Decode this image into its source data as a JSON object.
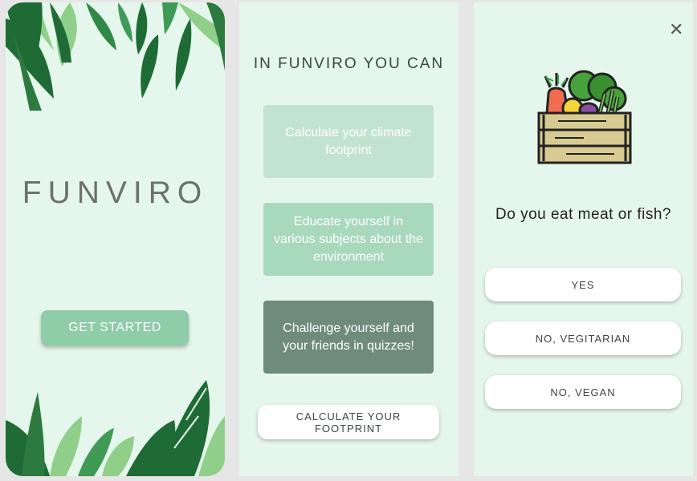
{
  "screen1": {
    "brand": "FUNVIRO",
    "start_label": "GET STARTED"
  },
  "screen2": {
    "title": "IN FUNVIRO YOU CAN",
    "cards": [
      "Calculate your climate footprint",
      "Educate yourself in various subjects about the environment",
      "Challenge yourself and your friends in quizzes!"
    ],
    "cta_label": "CALCULATE YOUR FOOTPRINT"
  },
  "screen3": {
    "close_icon": "close-icon",
    "illustration": "vegetable-crate-icon",
    "question": "Do you eat meat or fish?",
    "options": [
      "YES",
      "NO, VEGITARIAN",
      "NO, VEGAN"
    ]
  },
  "colors": {
    "background": "#e5f7ec",
    "primary_button": "#8fcca8",
    "card_light": "#c3e3d1",
    "card_mid": "#a8d9bd",
    "card_dark": "#6f8c7b",
    "leaf_dark": "#1f6b35",
    "leaf_mid": "#3f9a56",
    "leaf_light": "#8fcf8a"
  }
}
